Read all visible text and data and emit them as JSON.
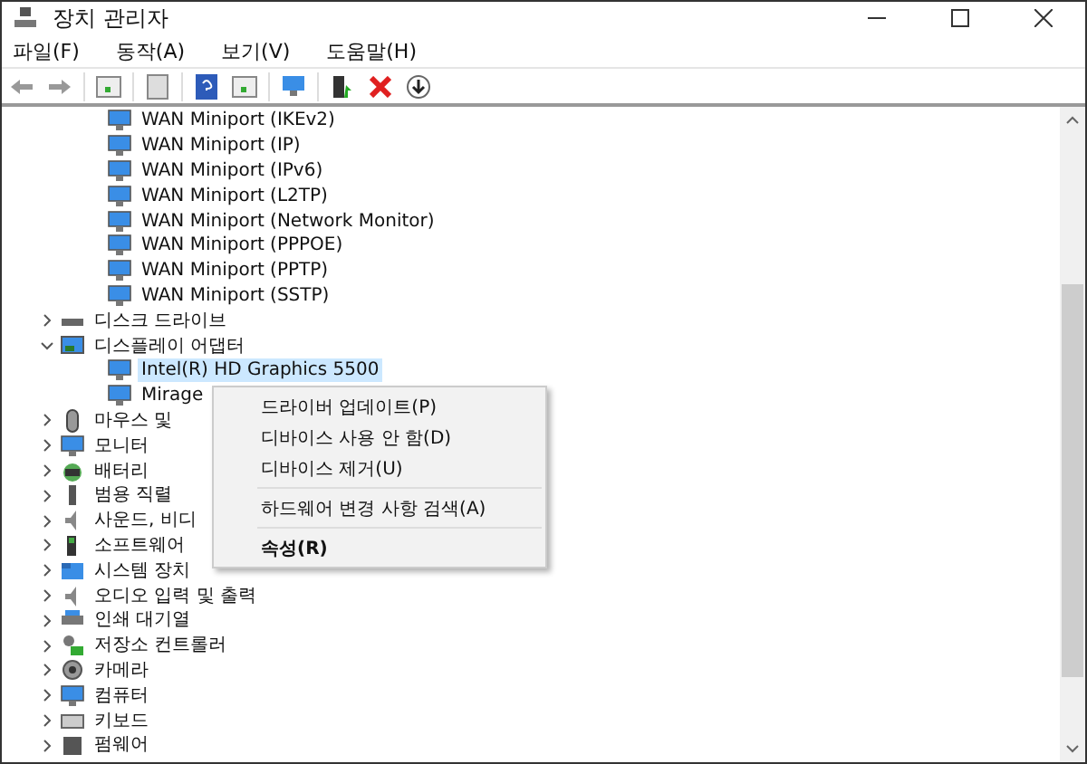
{
  "window": {
    "title": "장치 관리자"
  },
  "menu_bar": [
    {
      "label": "파일(F)"
    },
    {
      "label": "동작(A)"
    },
    {
      "label": "보기(V)"
    },
    {
      "label": "도움말(H)"
    }
  ],
  "tree": {
    "scrolled_children": [
      {
        "label": "WAN Miniport (IKEv2)"
      },
      {
        "label": "WAN Miniport (IP)"
      },
      {
        "label": "WAN Miniport (IPv6)"
      },
      {
        "label": "WAN Miniport (L2TP)"
      },
      {
        "label": "WAN Miniport (Network Monitor)"
      },
      {
        "label": "WAN Miniport (PPPOE)"
      },
      {
        "label": "WAN Miniport (PPTP)"
      },
      {
        "label": "WAN Miniport (SSTP)"
      }
    ],
    "items": [
      {
        "label": "디스크 드라이브",
        "expanded": false
      },
      {
        "label": "디스플레이 어댑터",
        "expanded": true,
        "children": [
          {
            "label": "Intel(R) HD Graphics 5500",
            "selected": true
          },
          {
            "label": "Mirage",
            "selected": false
          }
        ]
      },
      {
        "label": "마우스 및",
        "expanded": false
      },
      {
        "label": "모니터",
        "expanded": false
      },
      {
        "label": "배터리",
        "expanded": false
      },
      {
        "label": "범용 직렬",
        "expanded": false
      },
      {
        "label": "사운드, 비디",
        "expanded": false
      },
      {
        "label": "소프트웨어",
        "expanded": false
      },
      {
        "label": "시스템 장치",
        "expanded": false
      },
      {
        "label": "오디오 입력 및 출력",
        "expanded": false
      },
      {
        "label": "인쇄 대기열",
        "expanded": false
      },
      {
        "label": "저장소 컨트롤러",
        "expanded": false
      },
      {
        "label": "카메라",
        "expanded": false
      },
      {
        "label": "컴퓨터",
        "expanded": false
      },
      {
        "label": "키보드",
        "expanded": false
      },
      {
        "label": "펌웨어",
        "expanded": false
      }
    ]
  },
  "context_menu": [
    {
      "kind": "item",
      "label": "드라이버 업데이트(P)",
      "default": false
    },
    {
      "kind": "item",
      "label": "디바이스 사용 안 함(D)",
      "default": false
    },
    {
      "kind": "item",
      "label": "디바이스 제거(U)",
      "default": false
    },
    {
      "kind": "separator"
    },
    {
      "kind": "item",
      "label": "하드웨어 변경 사항 검색(A)",
      "default": false
    },
    {
      "kind": "separator"
    },
    {
      "kind": "item",
      "label": "속성(R)",
      "default": true
    }
  ]
}
